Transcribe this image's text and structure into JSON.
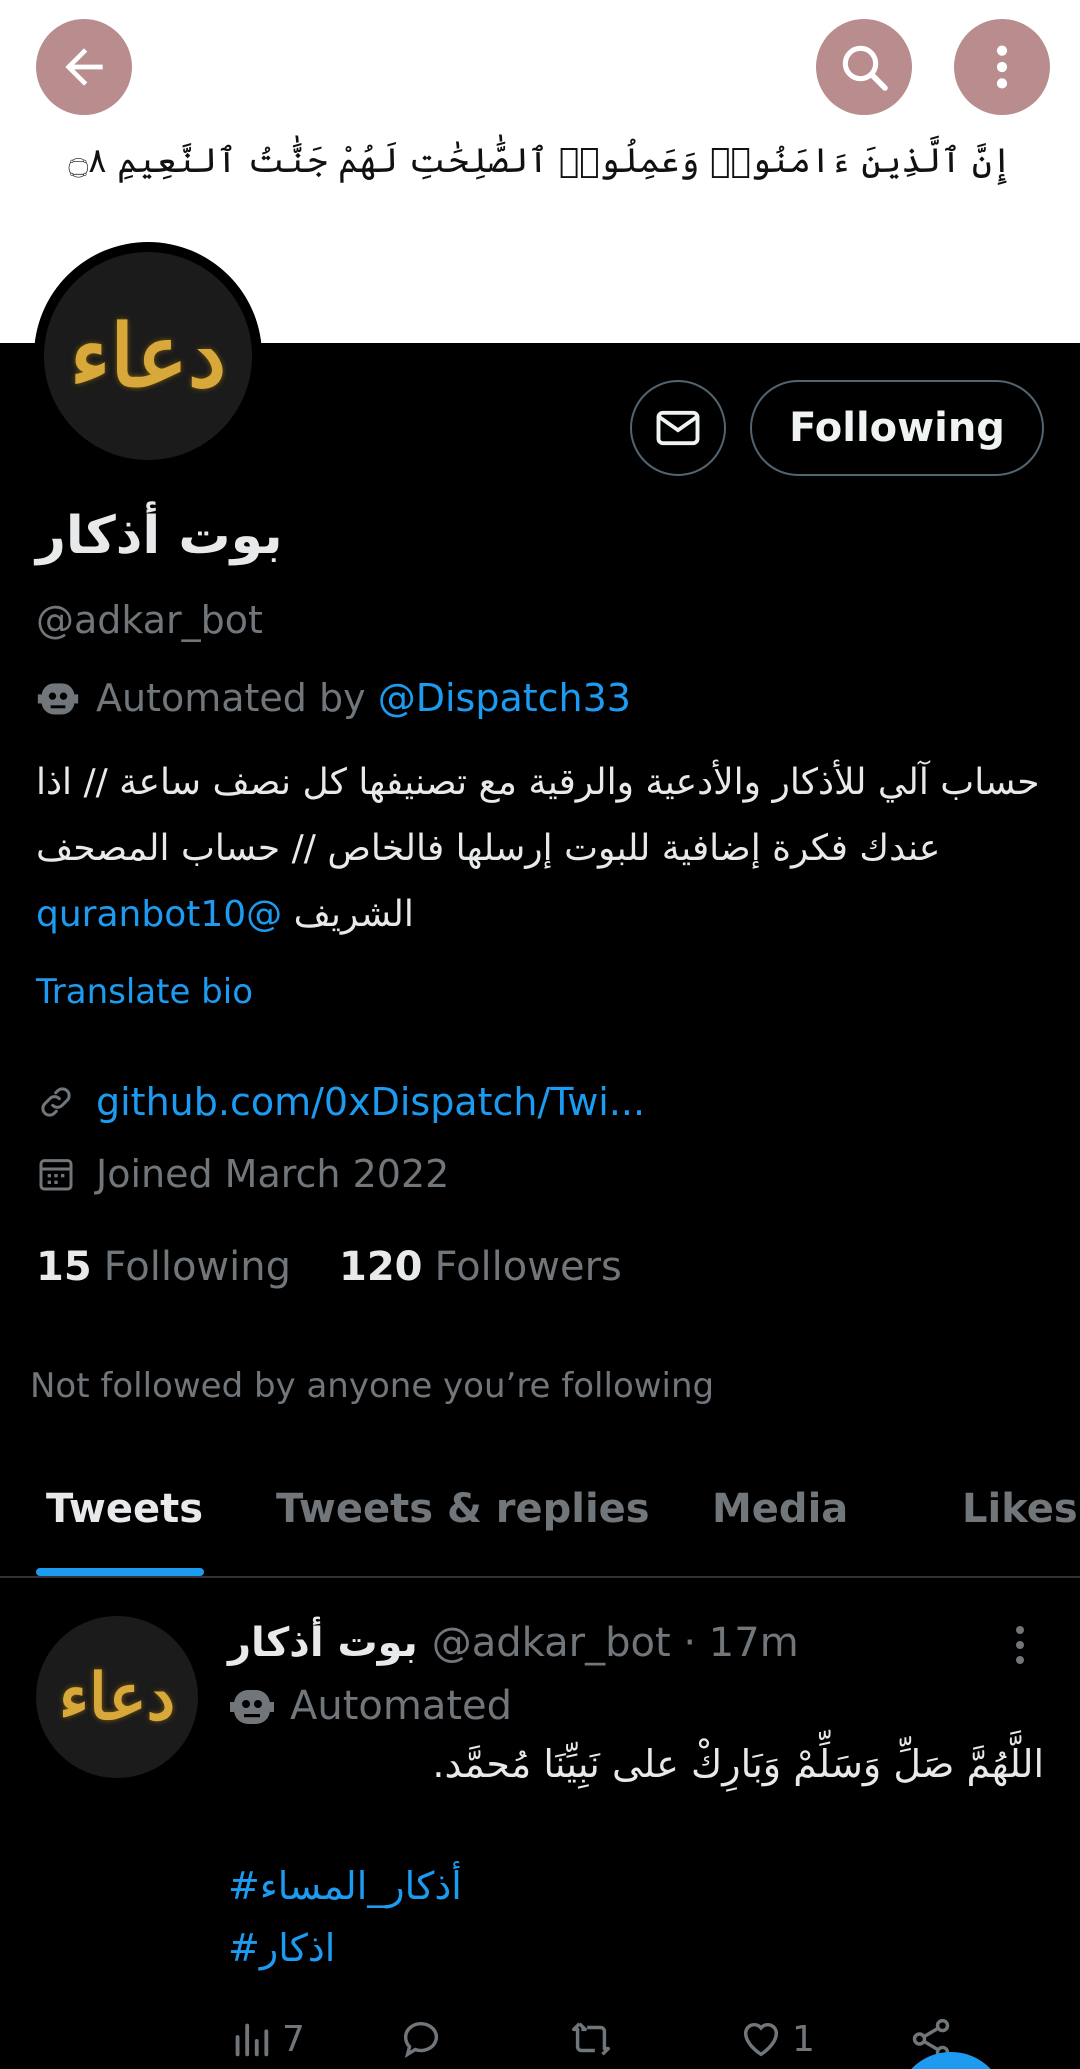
{
  "header": {
    "banner_verse": "إِنَّ ٱلَّذِينَ ءَامَنُوا۟ وَعَمِلُوا۟ ٱلصَّٰلِحَٰتِ لَهُمْ جَنَّٰتُ ٱلنَّعِيمِ ۝٨",
    "back_icon": "arrow-left-icon",
    "search_icon": "search-icon",
    "more_icon": "more-vertical-icon"
  },
  "profile": {
    "avatar_text": "دعاء",
    "name": "بوت أذكار",
    "handle": "@adkar_bot",
    "automated_prefix": "Automated by",
    "automated_by": "@Dispatch33",
    "bio_text": "حساب آلي للأذكار والأدعية والرقية مع تصنيفها كل نصف ساعة // اذا عندك فكرة إضافية للبوت إرسلها فالخاص // حساب المصحف الشريف",
    "bio_mention": "@quranbot10",
    "translate_label": "Translate bio",
    "url": "github.com/0xDispatch/Twi...",
    "joined": "Joined March 2022",
    "following_count": "15",
    "following_label": "Following",
    "followers_count": "120",
    "followers_label": "Followers",
    "not_followed": "Not followed by anyone you’re following",
    "follow_button": "Following",
    "message_icon": "mail-icon"
  },
  "tabs": [
    {
      "label": "Tweets",
      "active": true
    },
    {
      "label": "Tweets & replies",
      "active": false
    },
    {
      "label": "Media",
      "active": false
    },
    {
      "label": "Likes",
      "active": false
    }
  ],
  "tweet": {
    "name": "بوت أذكار",
    "handle": "@adkar_bot",
    "sep": "·",
    "time": "17m",
    "automated": "Automated",
    "text": "اللَّهُمَّ صَلِّ وَسَلِّمْ وَبَارِكْ على نَبِيِّنَا مُحمَّد.",
    "hashtag1": "#أذكار_المساء",
    "hashtag2": "#اذكار",
    "views": "7",
    "replies": "",
    "retweets": "",
    "likes": "1"
  },
  "colors": {
    "accent": "#1d9bf0",
    "background": "#000000",
    "muted": "#71767b",
    "header_button": "#b98c8e"
  }
}
